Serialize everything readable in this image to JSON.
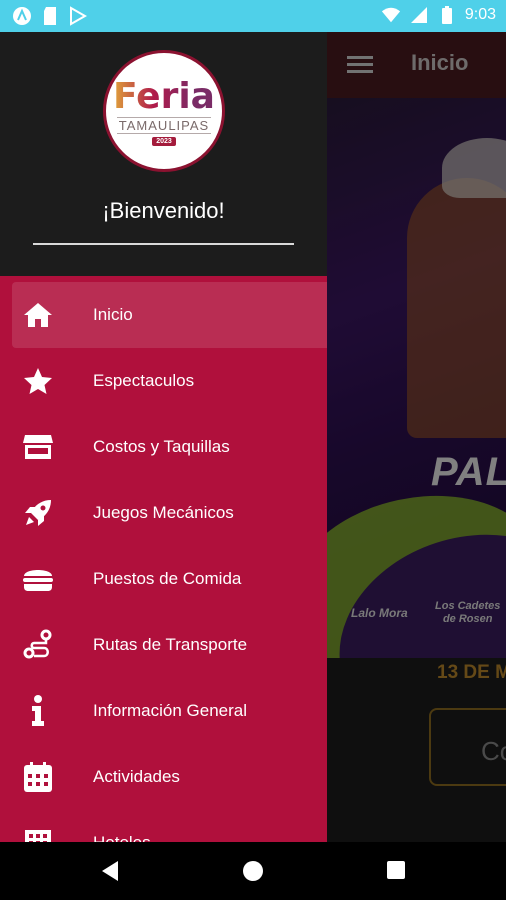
{
  "status_bar": {
    "time": "9:03",
    "icons": [
      "app-a-icon",
      "sd-card-icon",
      "play-store-icon",
      "wifi-icon",
      "signal-icon",
      "battery-icon"
    ]
  },
  "background_screen": {
    "title": "Inicio",
    "poster_title_fragment": "PAL",
    "artist_left": "Lalo Mora",
    "artist_right_line1": "Los Cadetes",
    "artist_right_line2": "de Rosen",
    "date_fragment": "13 DE M",
    "button_fragment": "Co"
  },
  "drawer": {
    "logo": {
      "word": "Feria",
      "state": "TAMAULIPAS",
      "year": "2023"
    },
    "welcome": "¡Bienvenido!",
    "menu": [
      {
        "label": "Inicio",
        "icon": "home-icon",
        "active": true
      },
      {
        "label": "Espectaculos",
        "icon": "star-icon",
        "active": false
      },
      {
        "label": "Costos y Taquillas",
        "icon": "store-icon",
        "active": false
      },
      {
        "label": "Juegos Mecánicos",
        "icon": "rocket-icon",
        "active": false
      },
      {
        "label": "Puestos de Comida",
        "icon": "burger-icon",
        "active": false
      },
      {
        "label": "Rutas de Transporte",
        "icon": "route-icon",
        "active": false
      },
      {
        "label": "Información General",
        "icon": "info-icon",
        "active": false
      },
      {
        "label": "Actividades",
        "icon": "calendar-icon",
        "active": false
      },
      {
        "label": "Hoteles",
        "icon": "hotel-icon",
        "active": false
      }
    ]
  },
  "colors": {
    "status_bar": "#4fd0e9",
    "drawer_menu": "#b0103c",
    "drawer_header": "#1c1c1c",
    "accent_gold": "#b8862a"
  },
  "nav_bar": {
    "buttons": [
      "back-icon",
      "home-circle-icon",
      "recents-icon"
    ]
  }
}
